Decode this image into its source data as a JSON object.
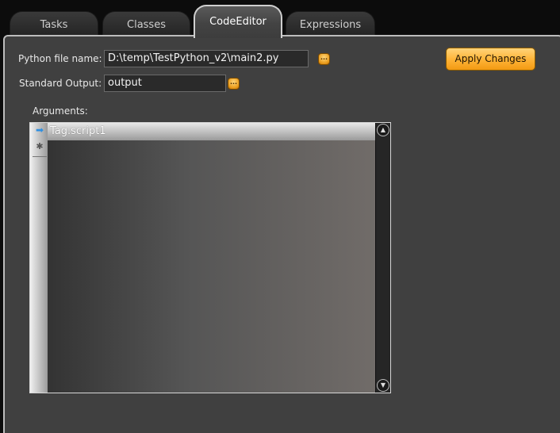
{
  "tabs": [
    {
      "label": "Tasks",
      "active": false
    },
    {
      "label": "Classes",
      "active": false
    },
    {
      "label": "CodeEditor",
      "active": true
    },
    {
      "label": "Expressions",
      "active": false
    }
  ],
  "form": {
    "python_file_label": "Python file name:",
    "python_file_value": "D:\\temp\\TestPython_v2\\main2.py",
    "std_output_label": "Standard Output:",
    "std_output_value": "output",
    "browse_glyph": "...",
    "apply_label": "Apply Changes",
    "arguments_label": "Arguments:"
  },
  "arguments_grid": {
    "rows": [
      {
        "marker": "➡",
        "value": "Tag.script1",
        "selected": true
      }
    ],
    "new_row_marker": "✱"
  },
  "colors": {
    "panel": "#404040",
    "accent": "#ffb53a"
  }
}
